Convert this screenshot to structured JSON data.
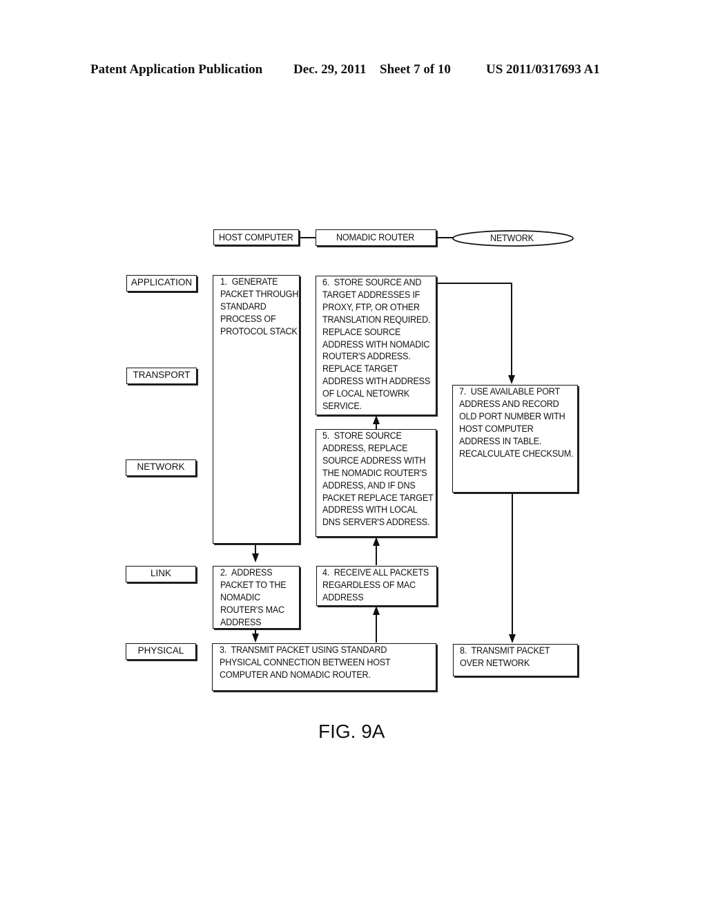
{
  "header": {
    "publication": "Patent Application Publication",
    "date": "Dec. 29, 2011",
    "sheet": "Sheet 7 of 10",
    "number": "US 2011/0317693 A1"
  },
  "entities": {
    "host": "HOST COMPUTER",
    "router": "NOMADIC ROUTER",
    "network": "NETWORK"
  },
  "layers": {
    "application": "APPLICATION",
    "transport": "TRANSPORT",
    "network": "NETWORK",
    "link": "LINK",
    "physical": "PHYSICAL"
  },
  "steps": {
    "s1": "1.  GENERATE\nPACKET THROUGH\nSTANDARD\nPROCESS OF\nPROTOCOL STACK",
    "s2": "2.  ADDRESS\nPACKET TO THE\nNOMADIC\nROUTER'S MAC\nADDRESS",
    "s3": "3.  TRANSMIT PACKET USING STANDARD\nPHYSICAL CONNECTION BETWEEN HOST\nCOMPUTER AND NOMADIC ROUTER.",
    "s4": "4.  RECEIVE ALL PACKETS\nREGARDLESS OF MAC\nADDRESS",
    "s5": "5.  STORE SOURCE\nADDRESS, REPLACE\nSOURCE ADDRESS WITH\nTHE NOMADIC ROUTER'S\nADDRESS, AND IF DNS\nPACKET REPLACE TARGET\nADDRESS WITH LOCAL\nDNS SERVER'S ADDRESS.",
    "s6": "6.  STORE SOURCE AND\nTARGET ADDRESSES IF\nPROXY, FTP, OR OTHER\nTRANSLATION REQUIRED.\nREPLACE SOURCE\nADDRESS WITH NOMADIC\nROUTER'S ADDRESS.\nREPLACE TARGET\nADDRESS WITH ADDRESS\nOF LOCAL NETOWRK\nSERVICE.",
    "s7": "7.  USE AVAILABLE PORT\nADDRESS AND RECORD\nOLD PORT NUMBER WITH\nHOST COMPUTER\nADDRESS IN TABLE.\nRECALCULATE CHECKSUM.",
    "s8": "8.  TRANSMIT PACKET\nOVER NETWORK"
  },
  "figure_label": "FIG. 9A"
}
